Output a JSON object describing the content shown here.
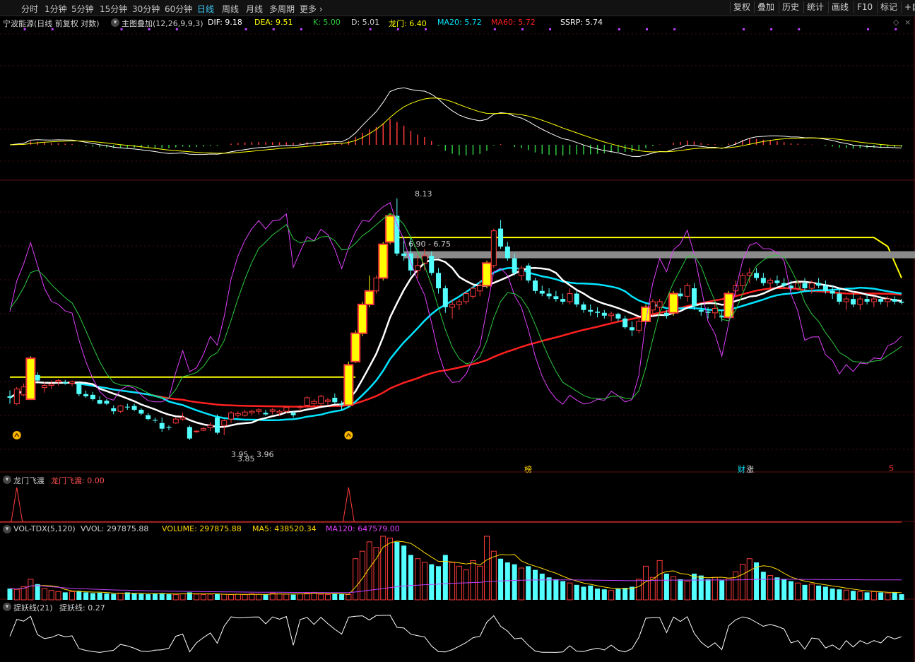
{
  "toolbar": {
    "timeframes": [
      "分时",
      "1分钟",
      "5分钟",
      "15分钟",
      "30分钟",
      "60分钟",
      "日线",
      "周线",
      "月线",
      "多周期",
      "更多"
    ],
    "active": "日线",
    "right_buttons": [
      "复权",
      "叠加",
      "历史",
      "统计",
      "画线",
      "F10",
      "标记",
      "+自"
    ]
  },
  "main_info": {
    "stock": "宁波能源(日线 前复权 对数)",
    "overlay": "主图叠加(12,26,9,9,3)",
    "dif": "DIF: 9.18",
    "dea": "DEA: 9.51",
    "k": "K: 5.00",
    "d": "D: 5.01",
    "longmen": "龙门: 6.40",
    "ma20": "MA20: 5.72",
    "ma60": "MA60: 5.72",
    "ssrp": "SSRP: 5.74"
  },
  "annotations": {
    "high": "8.13",
    "resistance": "6.90 - 6.75",
    "low_a": "3.95",
    "low_b": "3.96",
    "low_c": "3.85",
    "tag_bang": "榜",
    "tag_cai": "财",
    "tag_zhang": "涨",
    "tag_s": "S"
  },
  "panel_longmen": {
    "title": "龙门飞渡",
    "value": "龙门飞渡: 0.00"
  },
  "panel_vol": {
    "title": "VOL-TDX(5,120)",
    "vvol": "VVOL: 297875.88",
    "volume": "VOLUME: 297875.88",
    "ma5": "MA5: 438520.34",
    "ma120": "MA120: 647579.00"
  },
  "panel_yao": {
    "title": "捉妖线(21)",
    "value": "捉妖线: 0.27"
  },
  "colors": {
    "up": "#ff3b3b",
    "down": "#54ffff",
    "yellow": "#ffff00",
    "white": "#ffffff",
    "cyan": "#00e5ff",
    "red": "#ff2020",
    "magenta": "#e040fb",
    "green": "#2ecc40",
    "vol_ma5": "#ffd700",
    "vol_ma120": "#c040ff",
    "grid": "#4a0a0a"
  },
  "chart_data": {
    "type": "candlestick",
    "y_scale": "log",
    "ylim": [
      3.7,
      8.6
    ],
    "x": [
      1,
      2,
      3,
      4,
      5,
      6,
      7,
      8,
      9,
      10,
      11,
      12,
      13,
      14,
      15,
      16,
      17,
      18,
      19,
      20,
      21,
      22,
      23,
      24,
      25,
      26,
      27,
      28,
      29,
      30,
      31,
      32,
      33,
      34,
      35,
      36,
      37,
      38,
      39,
      40,
      41,
      42,
      43,
      44,
      45,
      46,
      47,
      48,
      49,
      50,
      51,
      52,
      53,
      54,
      55,
      56,
      57,
      58,
      59,
      60,
      61,
      62,
      63,
      64,
      65,
      66,
      67,
      68,
      69,
      70,
      71,
      72,
      73,
      74,
      75,
      76,
      77,
      78,
      79,
      80,
      81,
      82,
      83,
      84,
      85,
      86,
      87,
      88,
      89,
      90,
      91,
      92,
      93,
      94,
      95,
      96,
      97,
      98,
      99,
      100,
      101,
      102,
      103,
      104,
      105,
      106,
      107,
      108,
      109,
      110,
      111,
      112,
      113,
      114,
      115,
      116,
      117,
      118,
      119,
      120,
      121,
      122,
      123,
      124,
      125,
      126,
      127,
      128,
      129,
      130
    ],
    "ohlc": [
      [
        4.4,
        4.48,
        4.3,
        4.38
      ],
      [
        4.3,
        4.53,
        4.28,
        4.5
      ],
      [
        4.42,
        4.58,
        4.4,
        4.53
      ],
      [
        4.36,
        4.98,
        4.35,
        4.95
      ],
      [
        4.7,
        4.74,
        4.6,
        4.62
      ],
      [
        4.52,
        4.6,
        4.45,
        4.55
      ],
      [
        4.55,
        4.62,
        4.5,
        4.57
      ],
      [
        4.6,
        4.64,
        4.55,
        4.62
      ],
      [
        4.6,
        4.63,
        4.56,
        4.58
      ],
      [
        4.58,
        4.62,
        4.54,
        4.6
      ],
      [
        4.58,
        4.6,
        4.4,
        4.43
      ],
      [
        4.43,
        4.48,
        4.38,
        4.4
      ],
      [
        4.42,
        4.46,
        4.34,
        4.36
      ],
      [
        4.35,
        4.4,
        4.29,
        4.3
      ],
      [
        4.34,
        4.36,
        4.28,
        4.3
      ],
      [
        4.24,
        4.28,
        4.16,
        4.2
      ],
      [
        4.2,
        4.28,
        4.18,
        4.27
      ],
      [
        4.26,
        4.3,
        4.22,
        4.25
      ],
      [
        4.27,
        4.3,
        4.2,
        4.22
      ],
      [
        4.22,
        4.24,
        4.15,
        4.17
      ],
      [
        4.15,
        4.18,
        4.08,
        4.1
      ],
      [
        4.09,
        4.12,
        4.05,
        4.08
      ],
      [
        4.05,
        4.12,
        3.94,
        3.98
      ],
      [
        4.0,
        4.02,
        3.96,
        3.99
      ],
      [
        4.05,
        4.12,
        4.04,
        4.1
      ],
      [
        4.1,
        4.18,
        4.08,
        4.12
      ],
      [
        4.0,
        4.02,
        3.84,
        3.86
      ],
      [
        3.95,
        3.96,
        3.93,
        3.95
      ],
      [
        3.96,
        4.0,
        3.95,
        3.98
      ],
      [
        3.99,
        4.06,
        3.95,
        4.02
      ],
      [
        4.12,
        4.16,
        3.91,
        3.93
      ],
      [
        4.02,
        4.1,
        3.9,
        4.08
      ],
      [
        4.1,
        4.2,
        4.05,
        4.18
      ],
      [
        4.15,
        4.2,
        4.12,
        4.17
      ],
      [
        4.15,
        4.22,
        4.13,
        4.19
      ],
      [
        4.18,
        4.22,
        4.15,
        4.2
      ],
      [
        4.2,
        4.24,
        4.16,
        4.22
      ],
      [
        4.18,
        4.22,
        4.14,
        4.16
      ],
      [
        4.2,
        4.24,
        4.16,
        4.22
      ],
      [
        4.18,
        4.22,
        4.14,
        4.2
      ],
      [
        4.2,
        4.26,
        4.18,
        4.25
      ],
      [
        4.18,
        4.2,
        4.12,
        4.15
      ],
      [
        4.25,
        4.28,
        4.2,
        4.26
      ],
      [
        4.28,
        4.4,
        4.25,
        4.38
      ],
      [
        4.3,
        4.36,
        4.24,
        4.33
      ],
      [
        4.3,
        4.42,
        4.28,
        4.4
      ],
      [
        4.33,
        4.38,
        4.28,
        4.35
      ],
      [
        4.38,
        4.44,
        4.3,
        4.32
      ],
      [
        4.3,
        4.34,
        4.22,
        4.28
      ],
      [
        4.28,
        4.9,
        4.26,
        4.85
      ],
      [
        4.9,
        5.4,
        4.88,
        5.35
      ],
      [
        5.35,
        5.9,
        5.3,
        5.85
      ],
      [
        5.85,
        6.4,
        5.8,
        6.1
      ],
      [
        6.1,
        6.4,
        6.05,
        6.35
      ],
      [
        6.35,
        7.1,
        6.3,
        7.05
      ],
      [
        7.1,
        7.75,
        7.05,
        7.7
      ],
      [
        7.7,
        8.13,
        6.8,
        6.85
      ],
      [
        6.85,
        7.2,
        6.7,
        6.8
      ],
      [
        6.85,
        7.2,
        6.4,
        6.5
      ],
      [
        6.5,
        6.8,
        6.35,
        6.6
      ],
      [
        6.65,
        6.95,
        6.5,
        6.8
      ],
      [
        6.8,
        6.9,
        6.4,
        6.45
      ],
      [
        6.45,
        6.55,
        6.05,
        6.15
      ],
      [
        6.15,
        6.2,
        5.7,
        5.8
      ],
      [
        5.8,
        5.95,
        5.6,
        5.85
      ],
      [
        5.85,
        5.95,
        5.75,
        5.9
      ],
      [
        5.9,
        6.1,
        5.85,
        6.05
      ],
      [
        6.0,
        6.2,
        5.95,
        6.15
      ],
      [
        6.1,
        6.3,
        6.0,
        6.2
      ],
      [
        6.2,
        6.7,
        6.15,
        6.65
      ],
      [
        6.6,
        7.4,
        6.55,
        7.35
      ],
      [
        7.4,
        7.6,
        6.95,
        7.0
      ],
      [
        7.0,
        7.1,
        6.7,
        6.75
      ],
      [
        6.75,
        6.85,
        6.4,
        6.45
      ],
      [
        6.4,
        6.6,
        6.3,
        6.55
      ],
      [
        6.6,
        6.65,
        6.25,
        6.3
      ],
      [
        6.3,
        6.35,
        6.05,
        6.1
      ],
      [
        6.1,
        6.2,
        6.0,
        6.05
      ],
      [
        6.05,
        6.15,
        5.95,
        6.0
      ],
      [
        6.0,
        6.1,
        5.9,
        5.95
      ],
      [
        5.95,
        6.05,
        5.85,
        5.9
      ],
      [
        5.9,
        6.15,
        5.85,
        6.05
      ],
      [
        6.05,
        6.1,
        5.8,
        5.85
      ],
      [
        5.85,
        5.9,
        5.7,
        5.75
      ],
      [
        5.75,
        5.85,
        5.65,
        5.72
      ],
      [
        5.72,
        5.8,
        5.62,
        5.7
      ],
      [
        5.7,
        5.75,
        5.6,
        5.65
      ],
      [
        5.65,
        5.72,
        5.55,
        5.68
      ],
      [
        5.68,
        5.7,
        5.55,
        5.6
      ],
      [
        5.6,
        5.65,
        5.42,
        5.45
      ],
      [
        5.45,
        5.55,
        5.3,
        5.4
      ],
      [
        5.4,
        5.6,
        5.35,
        5.55
      ],
      [
        5.55,
        5.85,
        5.5,
        5.8
      ],
      [
        5.75,
        5.95,
        5.65,
        5.9
      ],
      [
        5.8,
        5.95,
        5.7,
        5.9
      ],
      [
        5.7,
        5.75,
        5.6,
        5.65
      ],
      [
        5.7,
        6.1,
        5.65,
        6.05
      ],
      [
        6.05,
        6.15,
        5.95,
        6.0
      ],
      [
        6.0,
        6.25,
        5.9,
        6.2
      ],
      [
        6.15,
        6.25,
        5.75,
        5.82
      ],
      [
        5.75,
        5.85,
        5.65,
        5.72
      ],
      [
        5.72,
        5.8,
        5.6,
        5.7
      ],
      [
        5.7,
        5.85,
        5.6,
        5.78
      ],
      [
        5.65,
        5.75,
        5.55,
        5.62
      ],
      [
        5.62,
        6.1,
        5.6,
        6.05
      ],
      [
        6.1,
        6.3,
        6.0,
        6.2
      ],
      [
        6.2,
        6.45,
        6.1,
        6.4
      ],
      [
        6.4,
        6.55,
        6.25,
        6.45
      ],
      [
        6.45,
        6.55,
        6.3,
        6.35
      ],
      [
        6.35,
        6.45,
        6.2,
        6.25
      ],
      [
        6.25,
        6.35,
        6.15,
        6.3
      ],
      [
        6.3,
        6.4,
        6.2,
        6.25
      ],
      [
        6.25,
        6.35,
        6.15,
        6.2
      ],
      [
        6.2,
        6.3,
        6.1,
        6.15
      ],
      [
        6.15,
        6.3,
        6.1,
        6.25
      ],
      [
        6.25,
        6.35,
        6.1,
        6.15
      ],
      [
        6.15,
        6.3,
        6.05,
        6.25
      ],
      [
        6.25,
        6.35,
        6.15,
        6.2
      ],
      [
        6.2,
        6.3,
        6.05,
        6.1
      ],
      [
        6.1,
        6.2,
        5.95,
        6.05
      ],
      [
        6.05,
        6.15,
        5.85,
        5.9
      ],
      [
        5.9,
        6.0,
        5.75,
        5.95
      ],
      [
        5.95,
        6.05,
        5.8,
        5.85
      ],
      [
        5.85,
        6.0,
        5.75,
        5.95
      ],
      [
        5.95,
        6.05,
        5.85,
        5.9
      ],
      [
        5.9,
        6.0,
        5.8,
        5.95
      ],
      [
        5.95,
        6.0,
        5.85,
        5.9
      ],
      [
        5.9,
        6.0,
        5.8,
        5.95
      ],
      [
        5.95,
        6.0,
        5.85,
        5.9
      ],
      [
        5.9,
        5.95,
        5.85,
        5.88
      ]
    ],
    "volume": [
      0.3,
      0.28,
      0.35,
      0.55,
      0.42,
      0.3,
      0.25,
      0.22,
      0.2,
      0.22,
      0.24,
      0.2,
      0.18,
      0.19,
      0.17,
      0.16,
      0.18,
      0.2,
      0.17,
      0.16,
      0.15,
      0.16,
      0.18,
      0.15,
      0.14,
      0.16,
      0.2,
      0.15,
      0.14,
      0.15,
      0.16,
      0.15,
      0.14,
      0.15,
      0.14,
      0.16,
      0.15,
      0.14,
      0.18,
      0.16,
      0.15,
      0.14,
      0.16,
      0.18,
      0.2,
      0.15,
      0.14,
      0.16,
      0.15,
      0.14,
      1.1,
      1.3,
      1.55,
      1.4,
      1.7,
      1.65,
      1.55,
      1.45,
      1.2,
      1.1,
      1.0,
      0.95,
      0.9,
      1.2,
      1.0,
      0.9,
      0.8,
      1.05,
      0.9,
      1.7,
      1.3,
      1.1,
      1.0,
      0.95,
      0.85,
      0.9,
      0.8,
      0.7,
      0.6,
      0.55,
      0.5,
      0.45,
      0.4,
      0.35,
      0.38,
      0.3,
      0.28,
      0.25,
      0.3,
      0.32,
      0.35,
      0.55,
      0.9,
      0.6,
      1.05,
      0.7,
      0.62,
      0.55,
      0.5,
      0.7,
      0.65,
      0.55,
      0.6,
      0.52,
      0.58,
      0.75,
      0.95,
      1.1,
      1.0,
      0.75,
      0.65,
      0.6,
      0.55,
      0.5,
      0.45,
      0.4,
      0.42,
      0.38,
      0.35,
      0.3,
      0.28,
      0.26,
      0.24,
      0.22,
      0.2,
      0.22,
      0.2,
      0.18,
      0.2,
      0.15
    ],
    "title": "宁波能源(日线 前复权 对数)"
  }
}
